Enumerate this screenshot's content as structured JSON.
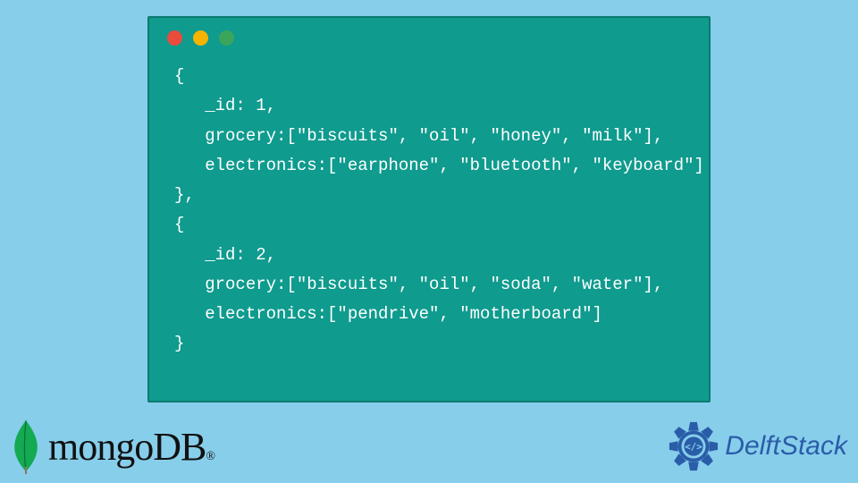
{
  "code": {
    "lines": [
      "{",
      "   _id: 1,",
      "   grocery:[\"biscuits\", \"oil\", \"honey\", \"milk\"],",
      "   electronics:[\"earphone\", \"bluetooth\", \"keyboard\"]",
      "},",
      "{",
      "   _id: 2,",
      "   grocery:[\"biscuits\", \"oil\", \"soda\", \"water\"],",
      "   electronics:[\"pendrive\", \"motherboard\"]",
      "}"
    ]
  },
  "logos": {
    "mongodb": "mongoDB",
    "mongodb_reg": "®",
    "delftstack": "DelftStack"
  },
  "colors": {
    "background": "#87ceeb",
    "window": "#0f9b8e",
    "mongo_leaf": "#13aa52",
    "delft_blue": "#2a5da8"
  }
}
